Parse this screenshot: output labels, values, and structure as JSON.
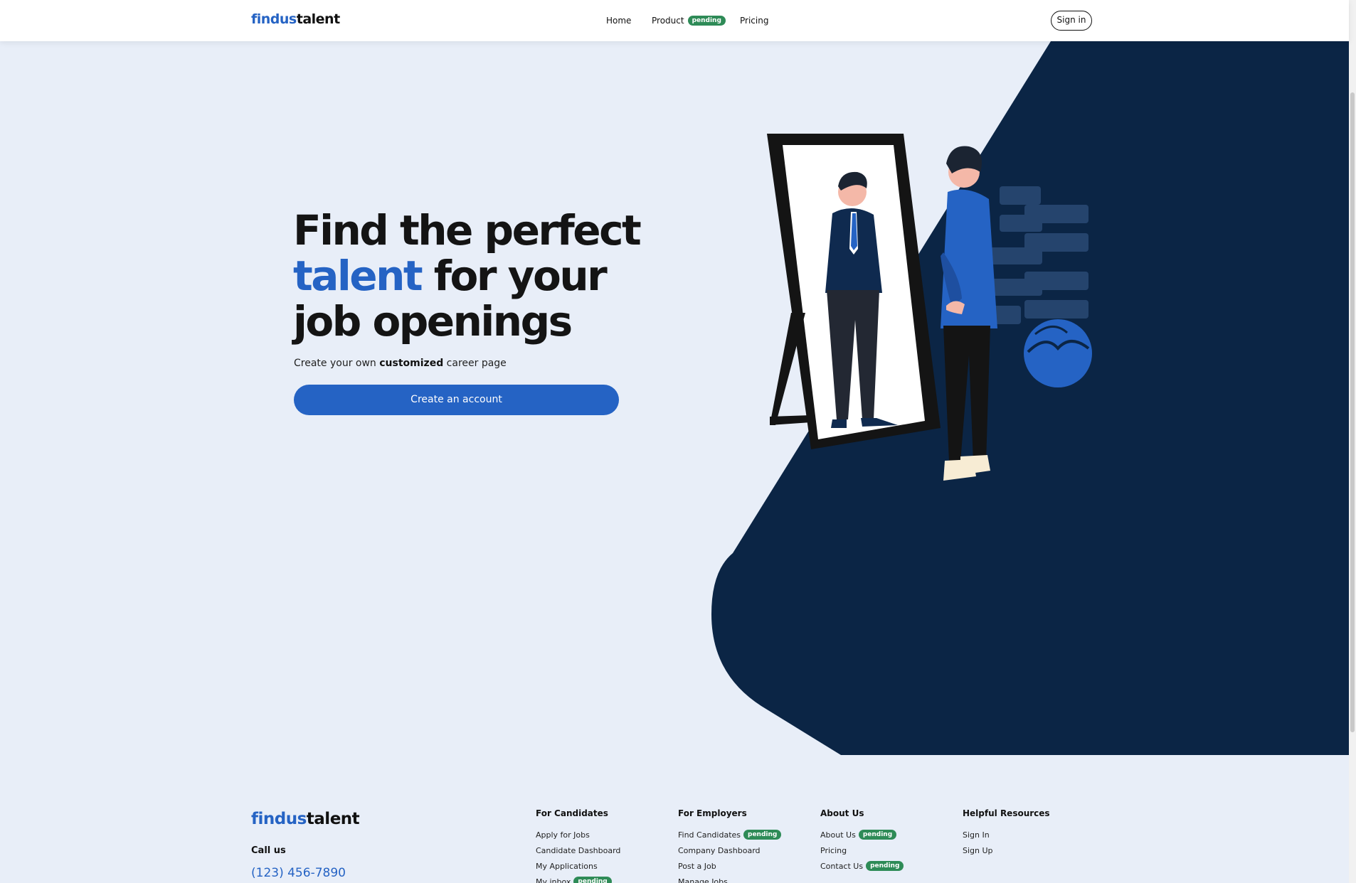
{
  "header": {
    "logo_a": "findus",
    "logo_b": "talent",
    "nav": [
      {
        "label": "Home"
      },
      {
        "label": "Product",
        "badge": "pending"
      },
      {
        "label": "Pricing"
      }
    ],
    "signin_label": "Sign in"
  },
  "hero": {
    "headline_line1": "Find the perfect",
    "headline_accent": "talent",
    "headline_line2_rest": " for your",
    "headline_line3": "job openings",
    "sub_pre": "Create your own ",
    "sub_bold": "customized",
    "sub_post": " career page",
    "cta_label": "Create an account"
  },
  "footer": {
    "logo_a": "findus",
    "logo_b": "talent",
    "call_label": "Call us",
    "phone": "(123) 456-7890",
    "columns": [
      {
        "title": "For Candidates",
        "links": [
          {
            "label": "Apply for Jobs"
          },
          {
            "label": "Candidate Dashboard"
          },
          {
            "label": "My Applications"
          },
          {
            "label": "My inbox",
            "badge": "pending"
          }
        ]
      },
      {
        "title": "For Employers",
        "links": [
          {
            "label": "Find Candidates",
            "badge": "pending"
          },
          {
            "label": "Company Dashboard"
          },
          {
            "label": "Post a Job"
          },
          {
            "label": "Manage Jobs"
          }
        ]
      },
      {
        "title": "About Us",
        "links": [
          {
            "label": "About Us",
            "badge": "pending"
          },
          {
            "label": "Pricing"
          },
          {
            "label": "Contact Us",
            "badge": "pending"
          }
        ]
      },
      {
        "title": "Helpful Resources",
        "links": [
          {
            "label": "Sign In"
          },
          {
            "label": "Sign Up"
          }
        ]
      }
    ]
  },
  "colors": {
    "brand_blue": "#2563c4",
    "navy": "#0b2545",
    "page_bg": "#e8eef8",
    "badge_green": "#2e8b57"
  }
}
